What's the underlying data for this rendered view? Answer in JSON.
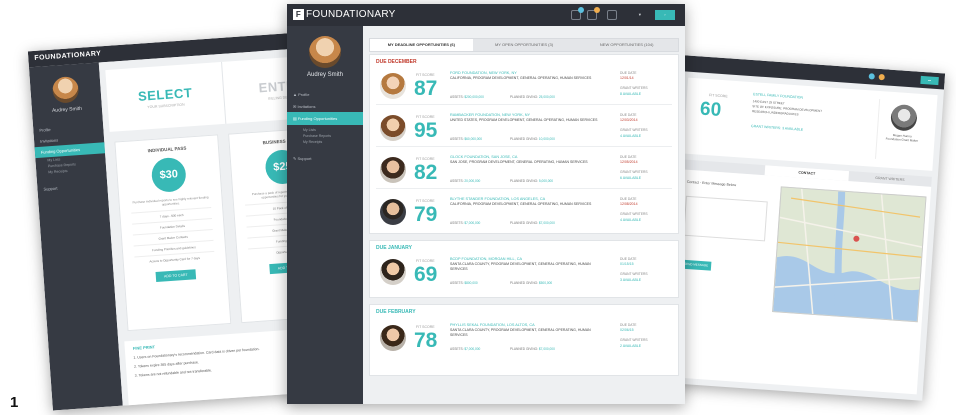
{
  "figure_number": "1",
  "app": {
    "logo_text": "FOUNDATIONARY",
    "logo_mark": "F",
    "user_name": "Audrey Smith"
  },
  "left": {
    "steps": [
      {
        "title": "SELECT",
        "subtitle": "YOUR SUBSCRIPTION"
      },
      {
        "title": "ENTER",
        "subtitle": "BILLING DETAILS"
      }
    ],
    "nav": [
      "Profile",
      "Invitations",
      "Funding Opportunities"
    ],
    "subnav": [
      "My Lists",
      "Purchase Reports",
      "My Receipts"
    ],
    "support": "Support",
    "plans": [
      {
        "name": "INDIVIDUAL PASS",
        "price": "$30",
        "desc": "Purchase individual reports to see highly relevant funding opportunities.",
        "features": [
          "7 days - $30 each",
          "Foundation Details",
          "Grant Maker Contacts",
          "Funding Priorities and guidelines",
          "Access to Opportunity Card for 7 days"
        ],
        "button": "ADD TO CART"
      },
      {
        "name": "BUSINESS PASS",
        "price": "$25",
        "desc": "Purchase a pack of reports to see highly relevant opportunities for your organization.",
        "features": [
          "10 Pack of Reports",
          "Foundation Details",
          "Grant Maker Contacts",
          "Funding Priorities",
          "Opportunity Cards"
        ],
        "button": "ADD TO CART"
      }
    ],
    "fine_print": {
      "title": "FINE PRINT",
      "lines": [
        "1. Users on Foundationary's recommendation. Card data is driven per foundation.",
        "2. Tokens expire 365 days after purchase.",
        "3. Tokens are not refundable and not transferable."
      ]
    }
  },
  "center": {
    "tabs": [
      "MY DEADLINE OPPORTUNITIES (6)",
      "MY OPEN OPPORTUNITIES (3)",
      "NEW OPPORTUNITIES (104)"
    ],
    "nav": [
      "Profile",
      "Invitations",
      "Funding Opportunities"
    ],
    "subnav": [
      "My Lists",
      "Purchase Reports",
      "My Receipts"
    ],
    "support": "Support",
    "labels": {
      "fit_score": "FIT SCORE",
      "due_date": "DUE DATE",
      "grant_writers": "GRANT WRITERS",
      "assets": "ASSETS:",
      "planned_giving": "PLANNED GIVING:"
    },
    "months": [
      {
        "label": "DUE DECEMBER",
        "color": "#c0392b",
        "rows": [
          {
            "score": "87",
            "name": "FORD FOUNDATION, NEW YORK, NY",
            "desc": "CALIFORNIA, PROGRAM DEVELOPMENT, GENERAL OPERATING, HUMAN SERVICES",
            "assets": "$200,000,000",
            "planned": "25,000,000",
            "due": "12/01/14",
            "writers": "8 AVAILABLE"
          },
          {
            "score": "95",
            "name": "RAMBACKER FOUNDATION, NEW YORK, NY",
            "desc": "UNITED STATES, PROGRAM DEVELOPMENT, GENERAL OPERATING, HUMAN SERVICES",
            "assets": "$60,000,000",
            "planned": "10,000,000",
            "due": "12/03/2014",
            "writers": "4 AVAILABLE"
          },
          {
            "score": "82",
            "name": "GLOCK FOUNDATION, SAN JOSE, CA",
            "desc": "SAN JOSE, PROGRAM DEVELOPMENT, GENERAL OPERATING, HUMAN SERVICES",
            "assets": "20,000,000",
            "planned": "5,000,000",
            "due": "12/05/2014",
            "writers": "6 AVAILABLE"
          },
          {
            "score": "79",
            "name": "BLYTHE STANDER FOUNDATION, LOS ANGELES, CA",
            "desc": "CALIFORNIA, PROGRAM DEVELOPMENT, GENERAL OPERATING, HUMAN SERVICES",
            "assets": "$7,000,000",
            "planned": "$7,000,000",
            "due": "12/08/2014",
            "writers": "4 AVAILABLE"
          }
        ]
      },
      {
        "label": "DUE JANUARY",
        "color": "#38b9b6",
        "rows": [
          {
            "score": "69",
            "name": "BCDP FOUNDATION, MORGAN HILL, CA",
            "desc": "SANTA CLARA COUNTY, PROGRAM DEVELOPMENT, GENERAL OPERATING, HUMAN SERVICES",
            "assets": "$800,000",
            "planned": "$500,000",
            "due": "01/15/15",
            "writers": "3 AVAILABLE"
          }
        ]
      },
      {
        "label": "DUE FEBRUARY",
        "color": "#38b9b6",
        "rows": [
          {
            "score": "78",
            "name": "PHYLLIS SEKAL FOUNDATION, LOS ALTOS, CA",
            "desc": "SANTA CLARA COUNTY, PROGRAM DEVELOPMENT, GENERAL OPERATING, HUMAN SERVICES",
            "assets": "$7,000,000",
            "planned": "$7,000,000",
            "due": "02/06/15",
            "writers": "2 AVAILABLE"
          }
        ]
      }
    ]
  },
  "right": {
    "fit_label": "FIT SCORE",
    "score": "60",
    "foundation_name": "ESTELL FAMILY FOUNDATION",
    "foundation_lines": [
      "1400 EAST 29 STREET",
      "SITE OF EXPOSURE: PROGRAM DEVELOPMENT",
      "RESEARCH UNDERGRADUATES"
    ],
    "grant_writers": "GRANT WRITERS: 3 AVAILABLE",
    "person_name": "Megan Hanna",
    "person_title": "Foundation Grant Maker",
    "tabs": [
      "",
      "CONTACT",
      "GRANT WRITERS"
    ],
    "contact_note": "Contact - Enter Message Below",
    "add_button": "SEND MESSAGE"
  }
}
